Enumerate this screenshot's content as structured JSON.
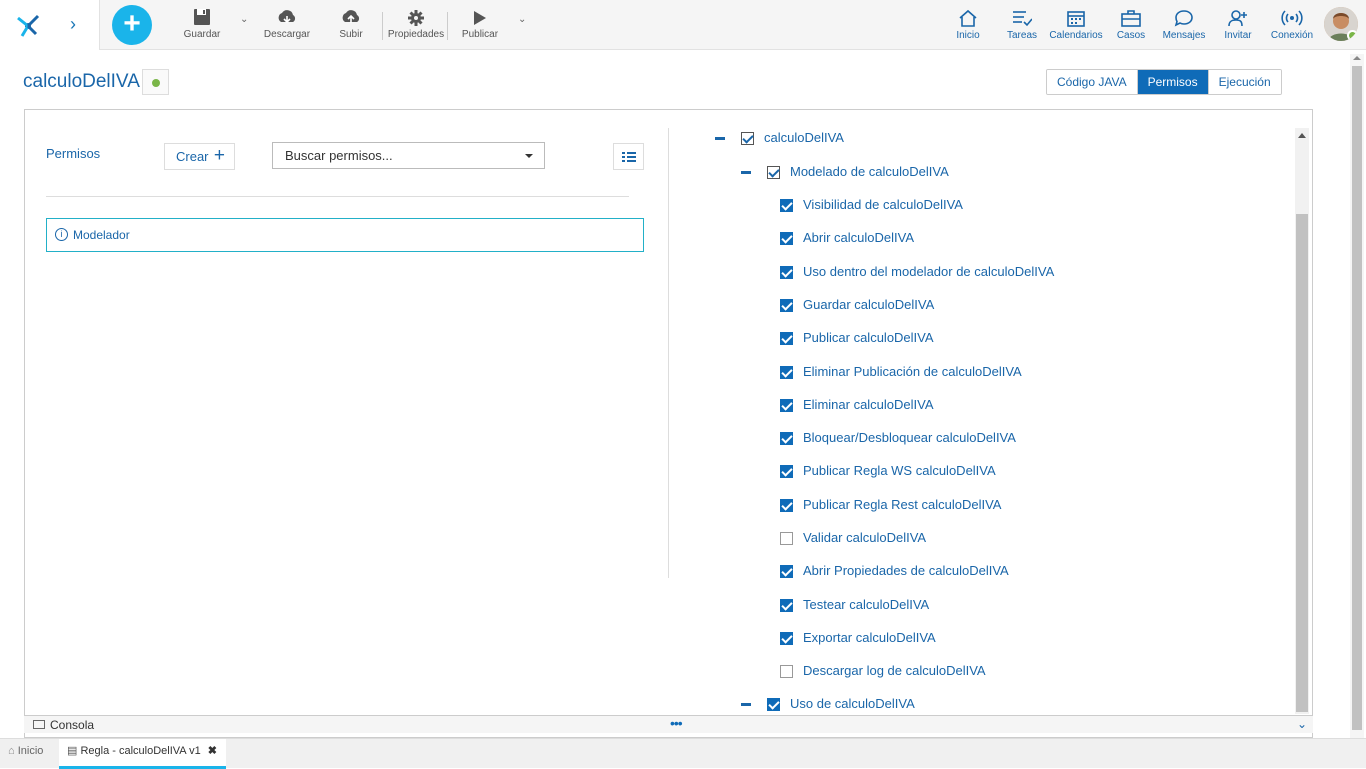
{
  "toolbar": {
    "guardar": "Guardar",
    "descargar": "Descargar",
    "subir": "Subir",
    "propiedades": "Propiedades",
    "publicar": "Publicar"
  },
  "nav": {
    "inicio": "Inicio",
    "tareas": "Tareas",
    "calendarios": "Calendarios",
    "casos": "Casos",
    "mensajes": "Mensajes",
    "invitar": "Invitar",
    "conexion": "Conexión"
  },
  "page": {
    "title": "calculoDelIVA",
    "tabs": [
      "Código JAVA",
      "Permisos",
      "Ejecución"
    ],
    "active_tab": "Permisos"
  },
  "left": {
    "label": "Permisos",
    "crear": "Crear",
    "search_placeholder": "Buscar permisos...",
    "item": "Modelador"
  },
  "tree": {
    "root": "calculoDelIVA",
    "group1": "Modelado de calculoDelIVA",
    "items": [
      {
        "label": "Visibilidad de calculoDelIVA",
        "checked": true
      },
      {
        "label": "Abrir calculoDelIVA",
        "checked": true
      },
      {
        "label": "Uso dentro del modelador de calculoDelIVA",
        "checked": true
      },
      {
        "label": "Guardar calculoDelIVA",
        "checked": true
      },
      {
        "label": "Publicar calculoDelIVA",
        "checked": true
      },
      {
        "label": "Eliminar Publicación de calculoDelIVA",
        "checked": true
      },
      {
        "label": "Eliminar calculoDelIVA",
        "checked": true
      },
      {
        "label": "Bloquear/Desbloquear calculoDelIVA",
        "checked": true
      },
      {
        "label": "Publicar Regla WS calculoDelIVA",
        "checked": true
      },
      {
        "label": "Publicar Regla Rest calculoDelIVA",
        "checked": true
      },
      {
        "label": "Validar calculoDelIVA",
        "checked": false
      },
      {
        "label": "Abrir Propiedades de calculoDelIVA",
        "checked": true
      },
      {
        "label": "Testear calculoDelIVA",
        "checked": true
      },
      {
        "label": "Exportar calculoDelIVA",
        "checked": true
      },
      {
        "label": "Descargar log de calculoDelIVA",
        "checked": false
      }
    ],
    "group2": "Uso de calculoDelIVA"
  },
  "console": {
    "label": "Consola"
  },
  "bottom_tabs": {
    "home": "Inicio",
    "current": "Regla - calculoDelIVA v1"
  },
  "colors": {
    "accent": "#1ab4ea",
    "primary": "#0f6bb8",
    "status": "#7ab648"
  }
}
